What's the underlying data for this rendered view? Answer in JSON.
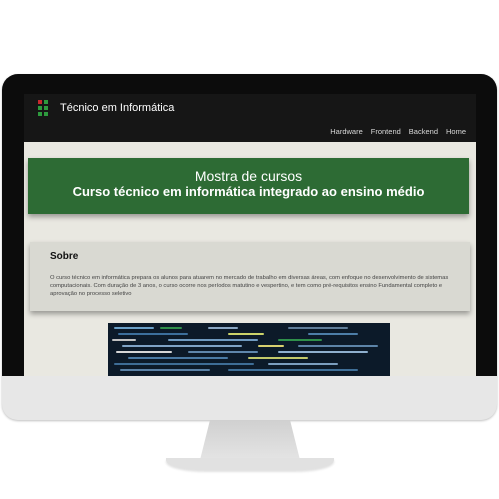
{
  "site": {
    "brand": "Técnico em Informática",
    "nav": [
      "Hardware",
      "Frontend",
      "Backend",
      "Home"
    ]
  },
  "hero": {
    "line1": "Mostra de cursos",
    "line2": "Curso técnico em informática integrado ao ensino médio"
  },
  "sobre": {
    "title": "Sobre",
    "text": "O curso técnico em informática prepara os alunos para atuarem no mercado de trabalho em diversas áreas, com enfoque no desenvolvimento de sistemas computacionais. Com duração de 3 anos, o curso ocorre nos períodos matutino e vespertino, e tem como pré-requisitos ensino Fundamental completo e aprovação no processo seletivo"
  },
  "colors": {
    "navbar": "#161616",
    "hero": "#2d6b34",
    "page": "#e9e8e1",
    "card": "#d9d9d2"
  },
  "image": {
    "name": "code-screenshot"
  }
}
